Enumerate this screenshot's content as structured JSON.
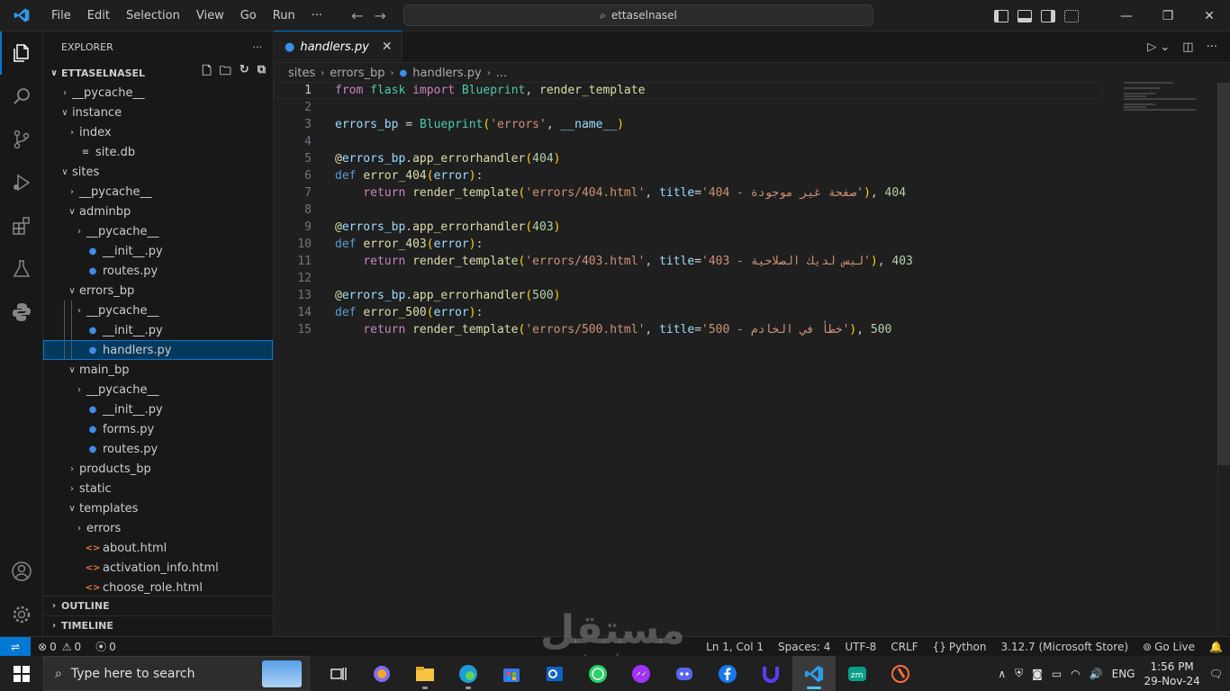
{
  "titlebar": {
    "menu": [
      "File",
      "Edit",
      "Selection",
      "View",
      "Go",
      "Run",
      "···"
    ],
    "search": "ettaselnasel"
  },
  "sidebar": {
    "header": "EXPLORER",
    "more": "···",
    "workspace": "ETTASELNASEL",
    "tree": [
      {
        "label": "__pycache__",
        "type": "folder",
        "open": false,
        "depth": 1
      },
      {
        "label": "instance",
        "type": "folder",
        "open": true,
        "depth": 1
      },
      {
        "label": "index",
        "type": "folder",
        "open": false,
        "depth": 2
      },
      {
        "label": "site.db",
        "type": "db",
        "depth": 2
      },
      {
        "label": "sites",
        "type": "folder",
        "open": true,
        "depth": 1
      },
      {
        "label": "__pycache__",
        "type": "folder",
        "open": false,
        "depth": 2
      },
      {
        "label": "adminbp",
        "type": "folder",
        "open": true,
        "depth": 2
      },
      {
        "label": "__pycache__",
        "type": "folder",
        "open": false,
        "depth": 3
      },
      {
        "label": "__init__.py",
        "type": "py",
        "depth": 3
      },
      {
        "label": "routes.py",
        "type": "py",
        "depth": 3
      },
      {
        "label": "errors_bp",
        "type": "folder",
        "open": true,
        "depth": 2
      },
      {
        "label": "__pycache__",
        "type": "folder",
        "open": false,
        "depth": 3
      },
      {
        "label": "__init__.py",
        "type": "py",
        "depth": 3
      },
      {
        "label": "handlers.py",
        "type": "py",
        "depth": 3,
        "selected": true
      },
      {
        "label": "main_bp",
        "type": "folder",
        "open": true,
        "depth": 2
      },
      {
        "label": "__pycache__",
        "type": "folder",
        "open": false,
        "depth": 3
      },
      {
        "label": "__init__.py",
        "type": "py",
        "depth": 3
      },
      {
        "label": "forms.py",
        "type": "py",
        "depth": 3
      },
      {
        "label": "routes.py",
        "type": "py",
        "depth": 3
      },
      {
        "label": "products_bp",
        "type": "folder",
        "open": false,
        "depth": 2
      },
      {
        "label": "static",
        "type": "folder",
        "open": false,
        "depth": 2
      },
      {
        "label": "templates",
        "type": "folder",
        "open": true,
        "depth": 2
      },
      {
        "label": "errors",
        "type": "folder",
        "open": false,
        "depth": 3
      },
      {
        "label": "about.html",
        "type": "html",
        "depth": 3
      },
      {
        "label": "activation_info.html",
        "type": "html",
        "depth": 3
      },
      {
        "label": "choose_role.html",
        "type": "html",
        "depth": 3
      }
    ],
    "outline": "OUTLINE",
    "timeline": "TIMELINE"
  },
  "editor": {
    "tab": "handlers.py",
    "breadcrumb": [
      "sites",
      "errors_bp",
      "handlers.py",
      "..."
    ],
    "lines": [
      "1",
      "2",
      "3",
      "4",
      "5",
      "6",
      "7",
      "8",
      "9",
      "10",
      "11",
      "12",
      "13",
      "14",
      "15"
    ]
  },
  "status": {
    "errors": "0",
    "warnings": "0",
    "ports": "0",
    "position": "Ln 1, Col 1",
    "spaces": "Spaces: 4",
    "encoding": "UTF-8",
    "eol": "CRLF",
    "language": "Python",
    "interpreter": "3.12.7 (Microsoft Store)",
    "golive": "Go Live"
  },
  "taskbar": {
    "search_placeholder": "Type here to search",
    "lang": "ENG",
    "time": "1:56 PM",
    "date": "29-Nov-24"
  },
  "watermark": {
    "main": "مستقل",
    "sub": "mostaql.com"
  },
  "colors": {
    "accent": "#0078d4",
    "selection": "#04395e"
  }
}
